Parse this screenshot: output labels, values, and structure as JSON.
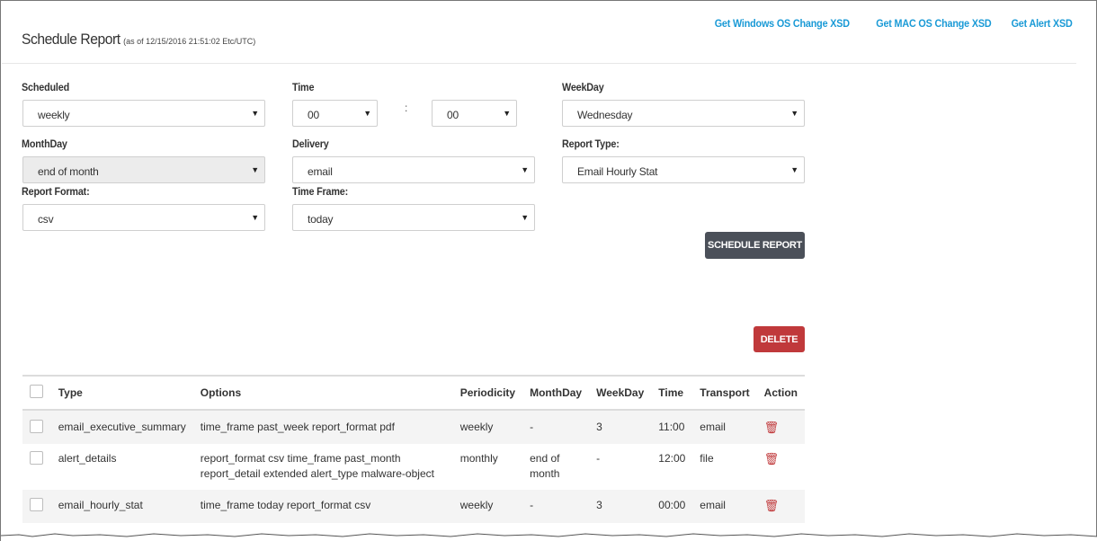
{
  "header": {
    "title": "Schedule Report",
    "as_of": "(as of 12/15/2016 21:51:02 Etc/UTC)",
    "links": [
      "Get Windows OS Change XSD",
      "Get MAC OS Change XSD",
      "Get Alert XSD"
    ]
  },
  "form": {
    "scheduled": {
      "label": "Scheduled",
      "value": "weekly"
    },
    "time": {
      "label": "Time",
      "hour": "00",
      "minute": "00",
      "separator": ":"
    },
    "weekday": {
      "label": "WeekDay",
      "value": "Wednesday"
    },
    "monthday": {
      "label": "MonthDay",
      "value": "end of month"
    },
    "delivery": {
      "label": "Delivery",
      "value": "email"
    },
    "report_type": {
      "label": "Report Type:",
      "value": "Email Hourly Stat"
    },
    "report_format": {
      "label": "Report Format:",
      "value": "csv"
    },
    "time_frame": {
      "label": "Time Frame:",
      "value": "today"
    }
  },
  "buttons": {
    "schedule": "SCHEDULE REPORT",
    "delete": "DELETE"
  },
  "table": {
    "columns": [
      "Type",
      "Options",
      "Periodicity",
      "MonthDay",
      "WeekDay",
      "Time",
      "Transport",
      "Action"
    ],
    "rows": [
      {
        "type": "email_executive_summary",
        "options": "time_frame past_week report_format pdf",
        "periodicity": "weekly",
        "monthday": "-",
        "weekday": "3",
        "time": "11:00",
        "transport": "email"
      },
      {
        "type": "alert_details",
        "options": "report_format csv time_frame past_month report_detail extended alert_type malware-object",
        "periodicity": "monthly",
        "monthday": "end of month",
        "weekday": "-",
        "time": "12:00",
        "transport": "file"
      },
      {
        "type": "email_hourly_stat",
        "options": "time_frame today report_format csv",
        "periodicity": "weekly",
        "monthday": "-",
        "weekday": "3",
        "time": "00:00",
        "transport": "email"
      }
    ]
  },
  "icons": {
    "select_caret": "caret-down-icon",
    "action": "trash-icon",
    "row_checkbox": "checkbox-icon"
  },
  "colors": {
    "link": "#1a9ad6",
    "schedule_button": "#4b5059",
    "delete_button": "#c0393b",
    "trash_icon": "#c0393b"
  }
}
